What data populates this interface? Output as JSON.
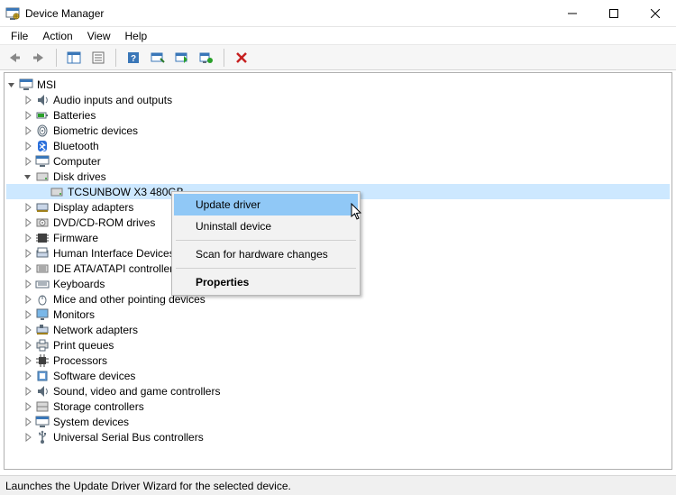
{
  "window": {
    "title": "Device Manager"
  },
  "menubar": {
    "file": "File",
    "action": "Action",
    "view": "View",
    "help": "Help"
  },
  "tree": {
    "root": "MSI",
    "selected_device": "TCSUNBOW X3 480GB",
    "categories": {
      "audio": "Audio inputs and outputs",
      "batteries": "Batteries",
      "biometric": "Biometric devices",
      "bluetooth": "Bluetooth",
      "computer": "Computer",
      "disks": "Disk drives",
      "display": "Display adapters",
      "dvd": "DVD/CD-ROM drives",
      "firmware": "Firmware",
      "hid": "Human Interface Devices",
      "ide": "IDE ATA/ATAPI controllers",
      "keyboards": "Keyboards",
      "mice": "Mice and other pointing devices",
      "monitors": "Monitors",
      "network": "Network adapters",
      "print": "Print queues",
      "processors": "Processors",
      "software": "Software devices",
      "sound": "Sound, video and game controllers",
      "storage": "Storage controllers",
      "system": "System devices",
      "usb": "Universal Serial Bus controllers"
    }
  },
  "context_menu": {
    "update_driver": "Update driver",
    "uninstall": "Uninstall device",
    "scan": "Scan for hardware changes",
    "properties": "Properties"
  },
  "status": {
    "text": "Launches the Update Driver Wizard for the selected device."
  }
}
